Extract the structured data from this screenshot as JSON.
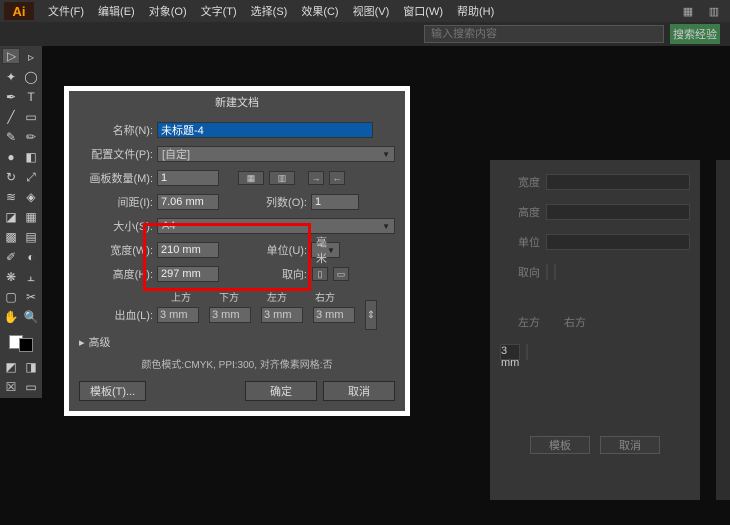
{
  "app": {
    "logo": "Ai"
  },
  "menu": {
    "items": [
      "文件(F)",
      "编辑(E)",
      "对象(O)",
      "文字(T)",
      "选择(S)",
      "效果(C)",
      "视图(V)",
      "窗口(W)",
      "帮助(H)"
    ]
  },
  "topbar": {
    "search_placeholder": "输入搜索内容",
    "search_btn": "搜索经验"
  },
  "dialog": {
    "title": "新建文档",
    "name_label": "名称(N):",
    "name_value": "未标题-4",
    "profile_label": "配置文件(P):",
    "profile_value": "[自定]",
    "artboards_label": "画板数量(M):",
    "artboards_value": "1",
    "spacing_label": "间距(I):",
    "spacing_value": "7.06 mm",
    "cols_label": "列数(O):",
    "cols_value": "1",
    "size_label": "大小(S):",
    "size_value": "A4",
    "width_label": "宽度(W):",
    "width_value": "210 mm",
    "height_label": "高度(H):",
    "height_value": "297 mm",
    "units_label": "单位(U):",
    "units_value": "毫米",
    "orient_label": "取向:",
    "bleed_label": "出血(L):",
    "bleed_top": "上方",
    "bleed_bottom": "下方",
    "bleed_left": "左方",
    "bleed_right": "右方",
    "bleed_val": "3 mm",
    "advanced": "高级",
    "info": "颜色模式:CMYK, PPI:300, 对齐像素网格:否",
    "templates_btn": "模板(T)...",
    "ok_btn": "确定",
    "cancel_btn": "取消"
  },
  "bg": {
    "r1": "宽度",
    "r2": "高度",
    "r3": "单位",
    "r4": "取向",
    "r5": "左方",
    "r6": "右方",
    "v1": "3 mm",
    "btn1": "模板",
    "btn2": "取消"
  }
}
